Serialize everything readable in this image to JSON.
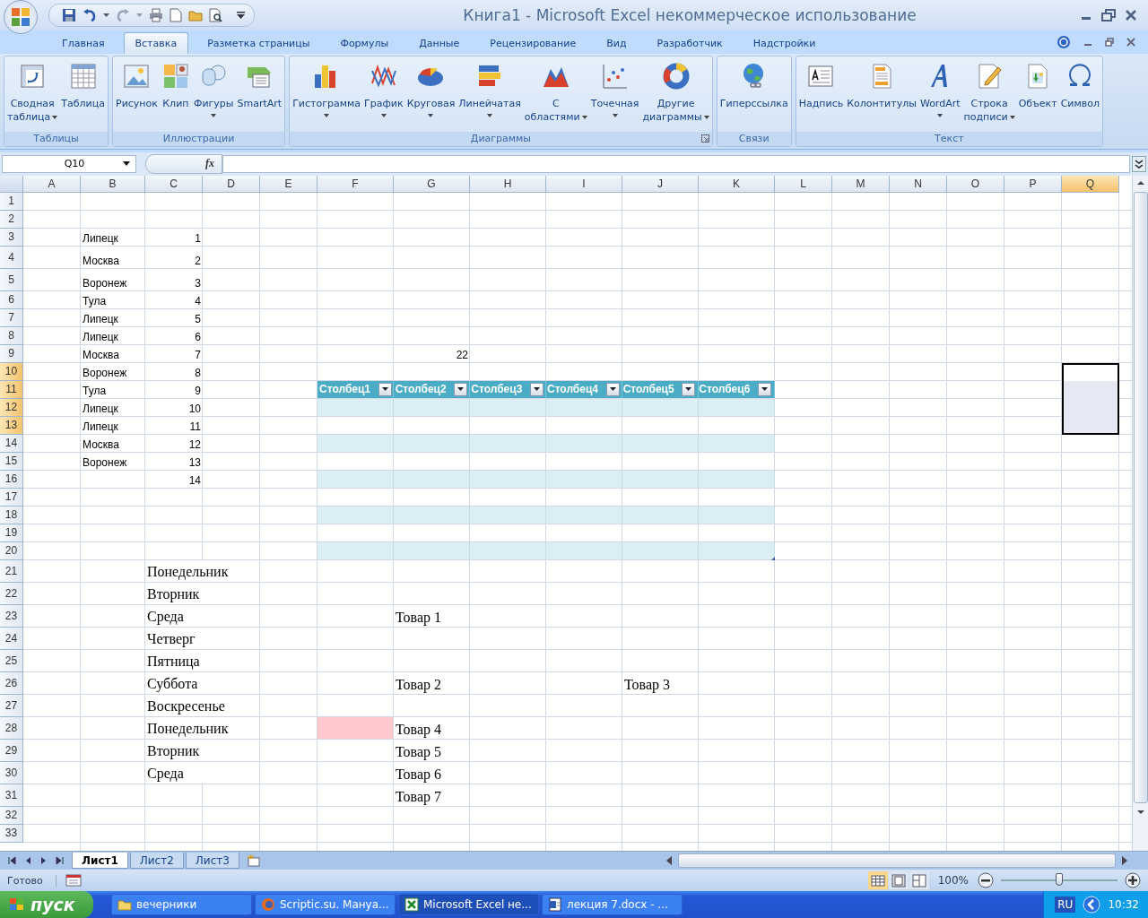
{
  "window": {
    "title": "Книга1 - Microsoft Excel некоммерческое использование"
  },
  "tabs": [
    {
      "label": "Главная",
      "selected": false
    },
    {
      "label": "Вставка",
      "selected": true
    },
    {
      "label": "Разметка страницы",
      "selected": false
    },
    {
      "label": "Формулы",
      "selected": false
    },
    {
      "label": "Данные",
      "selected": false
    },
    {
      "label": "Рецензирование",
      "selected": false
    },
    {
      "label": "Вид",
      "selected": false
    },
    {
      "label": "Разработчик",
      "selected": false
    },
    {
      "label": "Надстройки",
      "selected": false
    }
  ],
  "ribbon_groups": [
    {
      "title": "Таблицы",
      "launcher": false,
      "buttons": [
        {
          "lines": [
            "Сводная",
            "таблица"
          ],
          "dropdown": true
        },
        {
          "lines": [
            "Таблица"
          ],
          "dropdown": false
        }
      ]
    },
    {
      "title": "Иллюстрации",
      "launcher": false,
      "buttons": [
        {
          "lines": [
            "Рисунок"
          ],
          "dropdown": false
        },
        {
          "lines": [
            "Клип"
          ],
          "dropdown": false
        },
        {
          "lines": [
            "Фигуры"
          ],
          "dropdown": true
        },
        {
          "lines": [
            "SmartArt"
          ],
          "dropdown": false
        }
      ]
    },
    {
      "title": "Диаграммы",
      "launcher": true,
      "buttons": [
        {
          "lines": [
            "Гистограмма"
          ],
          "dropdown": true
        },
        {
          "lines": [
            "График"
          ],
          "dropdown": true
        },
        {
          "lines": [
            "Круговая"
          ],
          "dropdown": true
        },
        {
          "lines": [
            "Линейчатая"
          ],
          "dropdown": true
        },
        {
          "lines": [
            "С",
            "областями"
          ],
          "dropdown": true
        },
        {
          "lines": [
            "Точечная"
          ],
          "dropdown": true
        },
        {
          "lines": [
            "Другие",
            "диаграммы"
          ],
          "dropdown": true
        }
      ]
    },
    {
      "title": "Связи",
      "launcher": false,
      "buttons": [
        {
          "lines": [
            "Гиперссылка"
          ],
          "dropdown": false
        }
      ]
    },
    {
      "title": "Текст",
      "launcher": false,
      "buttons": [
        {
          "lines": [
            "Надпись"
          ],
          "dropdown": false
        },
        {
          "lines": [
            "Колонтитулы"
          ],
          "dropdown": false
        },
        {
          "lines": [
            "WordArt"
          ],
          "dropdown": true
        },
        {
          "lines": [
            "Строка",
            "подписи"
          ],
          "dropdown": true
        },
        {
          "lines": [
            "Объект"
          ],
          "dropdown": false
        },
        {
          "lines": [
            "Символ"
          ],
          "dropdown": false
        }
      ]
    }
  ],
  "formula_bar": {
    "name_box": "Q10",
    "function_button": "fx"
  },
  "columns": [
    {
      "letter": "A",
      "selected": false
    },
    {
      "letter": "B",
      "selected": false
    },
    {
      "letter": "C",
      "selected": false
    },
    {
      "letter": "D",
      "selected": false
    },
    {
      "letter": "E",
      "selected": false
    },
    {
      "letter": "F",
      "selected": false
    },
    {
      "letter": "G",
      "selected": false
    },
    {
      "letter": "H",
      "selected": false
    },
    {
      "letter": "I",
      "selected": false
    },
    {
      "letter": "J",
      "selected": false
    },
    {
      "letter": "K",
      "selected": false
    },
    {
      "letter": "L",
      "selected": false
    },
    {
      "letter": "M",
      "selected": false
    },
    {
      "letter": "N",
      "selected": false
    },
    {
      "letter": "O",
      "selected": false
    },
    {
      "letter": "P",
      "selected": false
    },
    {
      "letter": "Q",
      "selected": true
    }
  ],
  "rows": [
    {
      "number": "1",
      "selected": false
    },
    {
      "number": "2",
      "selected": false
    },
    {
      "number": "3",
      "selected": false,
      "cells": {
        "B": {
          "kind": "text",
          "text": "Липецк"
        },
        "C": {
          "kind": "number",
          "text": "1"
        }
      }
    },
    {
      "number": "4",
      "selected": false,
      "cells": {
        "B": {
          "kind": "text",
          "text": "Москва"
        },
        "C": {
          "kind": "number",
          "text": "2"
        }
      }
    },
    {
      "number": "5",
      "selected": false,
      "cells": {
        "B": {
          "kind": "text",
          "text": "Воронеж"
        },
        "C": {
          "kind": "number",
          "text": "3"
        }
      }
    },
    {
      "number": "6",
      "selected": false,
      "cells": {
        "B": {
          "kind": "text",
          "text": "Тула"
        },
        "C": {
          "kind": "number",
          "text": "4"
        }
      }
    },
    {
      "number": "7",
      "selected": false,
      "cells": {
        "B": {
          "kind": "text",
          "text": "Липецк"
        },
        "C": {
          "kind": "number",
          "text": "5"
        }
      }
    },
    {
      "number": "8",
      "selected": false,
      "cells": {
        "B": {
          "kind": "text",
          "text": "Липецк"
        },
        "C": {
          "kind": "number",
          "text": "6"
        }
      }
    },
    {
      "number": "9",
      "selected": false,
      "cells": {
        "B": {
          "kind": "text",
          "text": "Москва"
        },
        "C": {
          "kind": "number",
          "text": "7"
        },
        "G": {
          "kind": "number",
          "text": "22"
        }
      }
    },
    {
      "number": "10",
      "selected": true,
      "cells": {
        "B": {
          "kind": "text",
          "text": "Воронеж"
        },
        "C": {
          "kind": "number",
          "text": "8"
        }
      }
    },
    {
      "number": "11",
      "selected": true,
      "cells": {
        "B": {
          "kind": "text",
          "text": "Тула"
        },
        "C": {
          "kind": "number",
          "text": "9"
        }
      }
    },
    {
      "number": "12",
      "selected": true,
      "cells": {
        "B": {
          "kind": "text",
          "text": "Липецк"
        },
        "C": {
          "kind": "number",
          "text": "10"
        }
      }
    },
    {
      "number": "13",
      "selected": true,
      "cells": {
        "B": {
          "kind": "text",
          "text": "Липецк"
        },
        "C": {
          "kind": "number",
          "text": "11"
        }
      }
    },
    {
      "number": "14",
      "selected": false,
      "cells": {
        "B": {
          "kind": "text",
          "text": "Москва"
        },
        "C": {
          "kind": "number",
          "text": "12"
        }
      }
    },
    {
      "number": "15",
      "selected": false,
      "cells": {
        "B": {
          "kind": "text",
          "text": "Воронеж"
        },
        "C": {
          "kind": "number",
          "text": "13"
        }
      }
    },
    {
      "number": "16",
      "selected": false,
      "cells": {
        "C": {
          "kind": "number",
          "text": "14"
        }
      }
    },
    {
      "number": "17",
      "selected": false
    },
    {
      "number": "18",
      "selected": false
    },
    {
      "number": "19",
      "selected": false
    },
    {
      "number": "20",
      "selected": false
    },
    {
      "number": "21",
      "selected": false,
      "cells": {
        "C": {
          "kind": "serif",
          "text": "Понедельник"
        }
      }
    },
    {
      "number": "22",
      "selected": false,
      "cells": {
        "C": {
          "kind": "serif",
          "text": "Вторник"
        }
      }
    },
    {
      "number": "23",
      "selected": false,
      "cells": {
        "C": {
          "kind": "serif",
          "text": "Среда"
        },
        "G": {
          "kind": "serif",
          "text": "Товар 1"
        }
      }
    },
    {
      "number": "24",
      "selected": false,
      "cells": {
        "C": {
          "kind": "serif",
          "text": "Четверг"
        }
      }
    },
    {
      "number": "25",
      "selected": false,
      "cells": {
        "C": {
          "kind": "serif",
          "text": "Пятница"
        }
      }
    },
    {
      "number": "26",
      "selected": false,
      "cells": {
        "C": {
          "kind": "serif",
          "text": "Суббота"
        },
        "G": {
          "kind": "serif",
          "text": "Товар 2"
        },
        "J": {
          "kind": "serif",
          "text": "Товар 3"
        }
      }
    },
    {
      "number": "27",
      "selected": false,
      "cells": {
        "C": {
          "kind": "serif",
          "text": "Воскресенье"
        }
      }
    },
    {
      "number": "28",
      "selected": false,
      "cells": {
        "C": {
          "kind": "serif",
          "text": "Понедельник"
        },
        "F": {
          "kind": "fill",
          "color": "#ffc7ce"
        },
        "G": {
          "kind": "serif",
          "text": "Товар 4"
        }
      }
    },
    {
      "number": "29",
      "selected": false,
      "cells": {
        "C": {
          "kind": "serif",
          "text": "Вторник"
        },
        "G": {
          "kind": "serif",
          "text": "Товар 5"
        }
      }
    },
    {
      "number": "30",
      "selected": false,
      "cells": {
        "C": {
          "kind": "serif",
          "text": "Среда"
        },
        "G": {
          "kind": "serif",
          "text": "Товар 6"
        }
      }
    },
    {
      "number": "31",
      "selected": false,
      "cells": {
        "G": {
          "kind": "serif",
          "text": "Товар 7"
        }
      }
    },
    {
      "number": "32",
      "selected": false
    },
    {
      "number": "33",
      "selected": false
    }
  ],
  "table": {
    "columns": [
      {
        "label": "Столбец1"
      },
      {
        "label": "Столбец2"
      },
      {
        "label": "Столбец3"
      },
      {
        "label": "Столбец4"
      },
      {
        "label": "Столбец5"
      },
      {
        "label": "Столбец6"
      }
    ],
    "rows": [
      {
        "banded": true
      },
      {
        "banded": false
      },
      {
        "banded": true
      },
      {
        "banded": false
      },
      {
        "banded": true
      },
      {
        "banded": false
      },
      {
        "banded": true
      },
      {
        "banded": false
      },
      {
        "banded": true
      }
    ]
  },
  "sheet_tabs": [
    {
      "label": "Лист1",
      "selected": true
    },
    {
      "label": "Лист2",
      "selected": false
    },
    {
      "label": "Лист3",
      "selected": false
    }
  ],
  "status_bar": {
    "status": "Готово",
    "views": [
      {
        "selected": true
      },
      {
        "selected": false
      },
      {
        "selected": false
      }
    ],
    "zoom": {
      "reading": "100%",
      "level": 0.5
    }
  },
  "taskbar": {
    "start": "пуск",
    "tasks": [
      {
        "label": "вечерники",
        "selected": false
      },
      {
        "label": "Scriptic.su. Мануа...",
        "selected": false
      },
      {
        "label": "Microsoft Excel не...",
        "selected": true
      },
      {
        "label": "лекция 7.docx - ...",
        "selected": false
      }
    ],
    "language": "RU",
    "clock": "10:32"
  }
}
